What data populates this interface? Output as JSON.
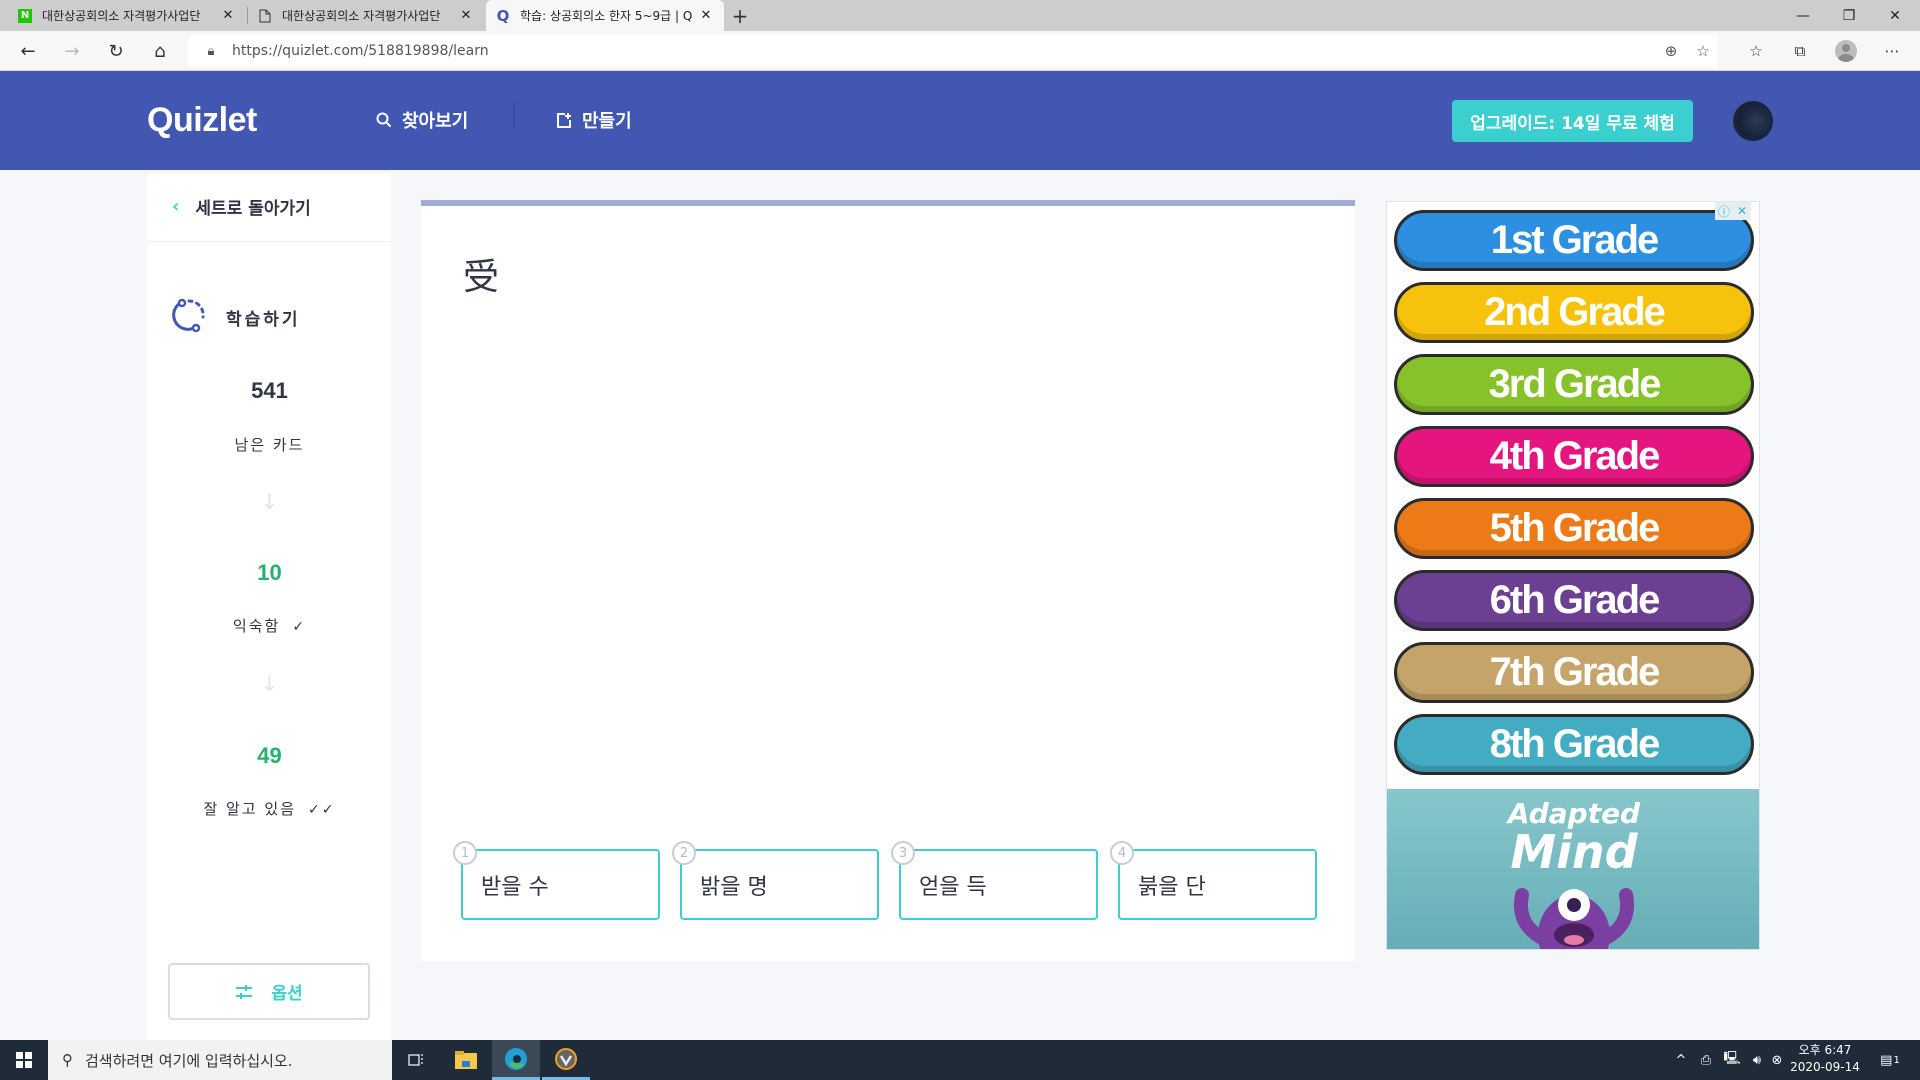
{
  "browser": {
    "tabs": [
      {
        "title": "대한상공회의소 자격평가사업단",
        "favicon": "naver-icon",
        "active": false
      },
      {
        "title": "대한상공회의소 자격평가사업단",
        "favicon": "page-icon",
        "active": false
      },
      {
        "title": "학습: 상공회의소 한자 5~9급 | Q",
        "favicon": "quizlet-icon",
        "active": true
      }
    ],
    "new_tab": "+",
    "url": "https://quizlet.com/518819898/learn",
    "window_controls": {
      "minimize": "—",
      "restore": "❐",
      "close": "✕"
    }
  },
  "header": {
    "logo": "Quizlet",
    "nav": [
      {
        "label": "찾아보기",
        "icon": "search-icon"
      },
      {
        "label": "만들기",
        "icon": "create-icon"
      }
    ],
    "upgrade_label": "업그레이드: 14일 무료 체험"
  },
  "sidebar": {
    "back_label": "세트로 돌아가기",
    "mode_label": "학습하기",
    "stats": [
      {
        "value": "541",
        "label": "남은 카드",
        "color": "#303545"
      },
      {
        "value": "10",
        "label": "익숙함",
        "color": "#23b26d",
        "check": "✓"
      },
      {
        "value": "49",
        "label": "잘 알고 있음",
        "color": "#23b26d",
        "check": "✓✓"
      }
    ],
    "options_label": "옵션"
  },
  "card": {
    "progress_fraction": 1.0,
    "term": "受",
    "answers": [
      {
        "number": "1",
        "text": "받을 수"
      },
      {
        "number": "2",
        "text": "밝을 명"
      },
      {
        "number": "3",
        "text": "얻을 득"
      },
      {
        "number": "4",
        "text": "붉을 단"
      }
    ]
  },
  "ad": {
    "info": "ⓘ",
    "close": "✕",
    "grades": [
      {
        "label": "1st Grade",
        "color": "#2d8fe0"
      },
      {
        "label": "2nd Grade",
        "color": "#f7c20b"
      },
      {
        "label": "3rd Grade",
        "color": "#86c22a"
      },
      {
        "label": "4th Grade",
        "color": "#e5157f"
      },
      {
        "label": "5th Grade",
        "color": "#ec7a17"
      },
      {
        "label": "6th Grade",
        "color": "#6b3f91"
      },
      {
        "label": "7th Grade",
        "color": "#c5a46a"
      },
      {
        "label": "8th Grade",
        "color": "#43acc2"
      }
    ],
    "brand_line1": "Adapted",
    "brand_line2": "Mind"
  },
  "taskbar": {
    "search_placeholder": "검색하려면 여기에 입력하십시오.",
    "time": "오후 6:47",
    "date": "2020-09-14",
    "notification_count": "1"
  }
}
